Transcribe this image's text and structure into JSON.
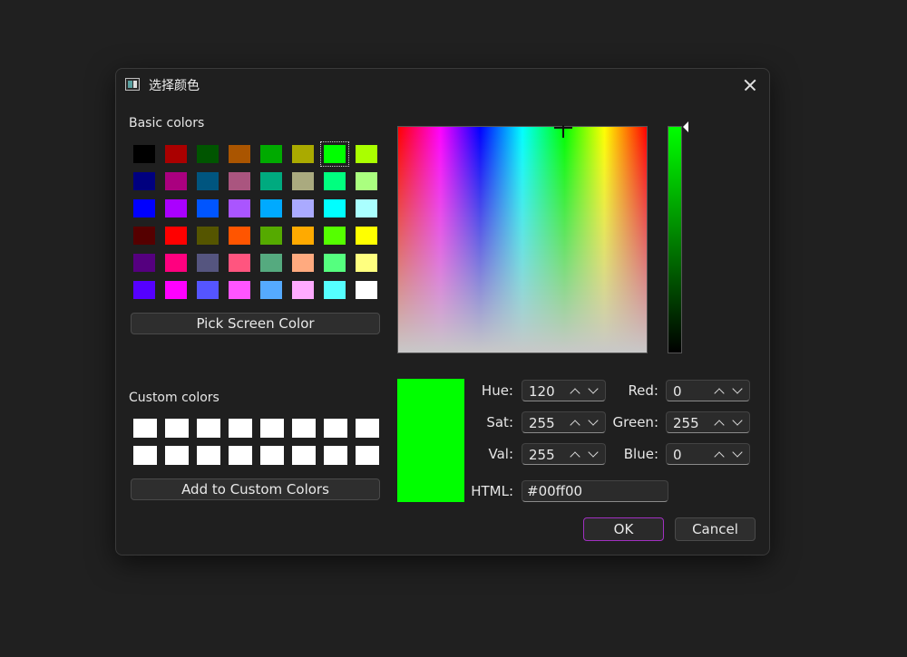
{
  "window": {
    "title": "选择颜色"
  },
  "basic_colors": {
    "label": "Basic colors",
    "swatches": [
      [
        "#000000",
        "#aa0000",
        "#005500",
        "#aa5500",
        "#00aa00",
        "#aaaa00",
        "#00ff00",
        "#aaff00"
      ],
      [
        "#00007f",
        "#aa007f",
        "#00557f",
        "#aa557f",
        "#00aa7f",
        "#aaaa7f",
        "#00ff7f",
        "#aaff7f"
      ],
      [
        "#0000ff",
        "#aa00ff",
        "#0055ff",
        "#aa55ff",
        "#00aaff",
        "#aaaaff",
        "#00ffff",
        "#aaffff"
      ],
      [
        "#550000",
        "#ff0000",
        "#555500",
        "#ff5500",
        "#55aa00",
        "#ffaa00",
        "#55ff00",
        "#ffff00"
      ],
      [
        "#55007f",
        "#ff007f",
        "#55557f",
        "#ff557f",
        "#55aa7f",
        "#ffaa7f",
        "#55ff7f",
        "#ffff7f"
      ],
      [
        "#5500ff",
        "#ff00ff",
        "#5555ff",
        "#ff55ff",
        "#55aaff",
        "#ffaaff",
        "#55ffff",
        "#ffffff"
      ]
    ],
    "selected": "#00ff00"
  },
  "pick_screen_color": "Pick Screen Color",
  "custom_colors": {
    "label": "Custom colors",
    "rows": 2,
    "cols": 8,
    "color": "#ffffff"
  },
  "add_to_custom": "Add to Custom Colors",
  "current_color": "#00ff00",
  "fields": {
    "hue": {
      "label": "Hue:",
      "value": "120"
    },
    "sat": {
      "label": "Sat:",
      "value": "255"
    },
    "val": {
      "label": "Val:",
      "value": "255"
    },
    "red": {
      "label": "Red:",
      "value": "0"
    },
    "green": {
      "label": "Green:",
      "value": "255"
    },
    "blue": {
      "label": "Blue:",
      "value": "0"
    },
    "html": {
      "label": "HTML:",
      "value": "#00ff00"
    }
  },
  "buttons": {
    "ok": "OK",
    "cancel": "Cancel"
  }
}
